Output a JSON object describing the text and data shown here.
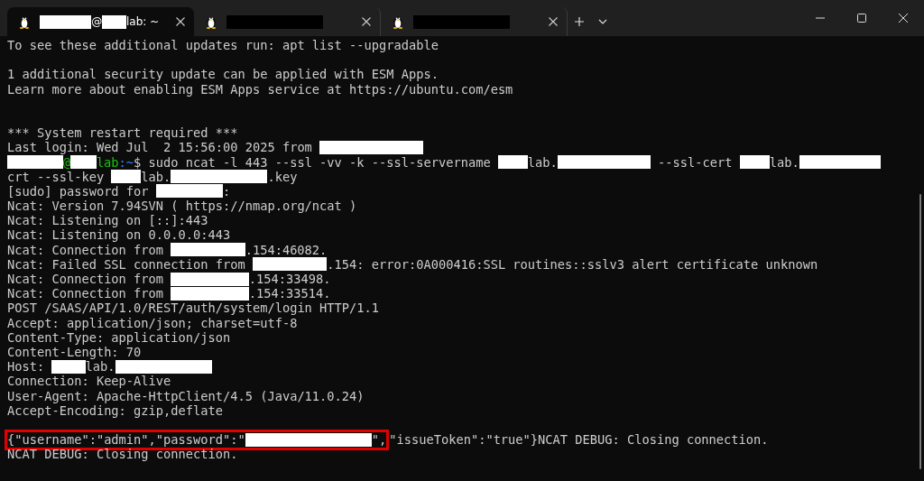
{
  "tabs": [
    {
      "selected": true,
      "title": [
        {
          "kind": "redacted"
        },
        {
          "kind": "text",
          "text": "@"
        },
        {
          "kind": "redacted"
        },
        {
          "kind": "text",
          "text": "lab: ~"
        }
      ]
    },
    {
      "selected": false,
      "title": [
        {
          "kind": "redacted"
        }
      ]
    },
    {
      "selected": false,
      "title": [
        {
          "kind": "redacted"
        }
      ]
    }
  ],
  "lines": [
    {
      "kind": "output",
      "segments": [
        {
          "kind": "text",
          "text": "To see these additional updates run: apt list --upgradable"
        }
      ]
    },
    {
      "kind": "blank"
    },
    {
      "kind": "output",
      "segments": [
        {
          "kind": "text",
          "text": "1 additional security update can be applied with ESM Apps."
        }
      ]
    },
    {
      "kind": "output",
      "segments": [
        {
          "kind": "text",
          "text": "Learn more about enabling ESM Apps service at https://ubuntu.com/esm"
        }
      ]
    },
    {
      "kind": "blank"
    },
    {
      "kind": "blank"
    },
    {
      "kind": "output",
      "segments": [
        {
          "kind": "text",
          "text": "*** System restart required ***"
        }
      ]
    },
    {
      "kind": "output",
      "segments": [
        {
          "kind": "text",
          "text": "Last login: Wed Jul  2 15:56:00 2025 from "
        },
        {
          "kind": "redacted"
        }
      ]
    },
    {
      "kind": "output",
      "segments": [
        {
          "kind": "redacted"
        },
        {
          "kind": "user",
          "text": "@"
        },
        {
          "kind": "redacted"
        },
        {
          "kind": "user",
          "text": "lab"
        },
        {
          "kind": "path",
          "text": ":~"
        },
        {
          "kind": "text",
          "text": "$ sudo ncat -l 443 --ssl -vv -k --ssl-servername "
        },
        {
          "kind": "redacted"
        },
        {
          "kind": "text",
          "text": "lab."
        },
        {
          "kind": "redacted"
        },
        {
          "kind": "text",
          "text": " --ssl-cert "
        },
        {
          "kind": "redacted"
        },
        {
          "kind": "text",
          "text": "lab."
        },
        {
          "kind": "redacted"
        }
      ]
    },
    {
      "kind": "output",
      "segments": [
        {
          "kind": "text",
          "text": "crt --ssl-key "
        },
        {
          "kind": "redacted"
        },
        {
          "kind": "text",
          "text": "lab."
        },
        {
          "kind": "redacted"
        },
        {
          "kind": "text",
          "text": ".key"
        }
      ]
    },
    {
      "kind": "output",
      "segments": [
        {
          "kind": "text",
          "text": "[sudo] password for "
        },
        {
          "kind": "redacted"
        },
        {
          "kind": "text",
          "text": ":"
        }
      ]
    },
    {
      "kind": "output",
      "segments": [
        {
          "kind": "text",
          "text": "Ncat: Version 7.94SVN ( https://nmap.org/ncat )"
        }
      ]
    },
    {
      "kind": "output",
      "segments": [
        {
          "kind": "text",
          "text": "Ncat: Listening on [::]:443"
        }
      ]
    },
    {
      "kind": "output",
      "segments": [
        {
          "kind": "text",
          "text": "Ncat: Listening on 0.0.0.0:443"
        }
      ]
    },
    {
      "kind": "output",
      "segments": [
        {
          "kind": "text",
          "text": "Ncat: Connection from "
        },
        {
          "kind": "redacted"
        },
        {
          "kind": "text",
          "text": ".154:46082."
        }
      ]
    },
    {
      "kind": "output",
      "segments": [
        {
          "kind": "text",
          "text": "Ncat: Failed SSL connection from "
        },
        {
          "kind": "redacted"
        },
        {
          "kind": "text",
          "text": ".154: error:0A000416:SSL routines::sslv3 alert certificate unknown"
        }
      ]
    },
    {
      "kind": "output",
      "segments": [
        {
          "kind": "text",
          "text": "Ncat: Connection from "
        },
        {
          "kind": "redacted"
        },
        {
          "kind": "text",
          "text": ".154:33498."
        }
      ]
    },
    {
      "kind": "output",
      "segments": [
        {
          "kind": "text",
          "text": "Ncat: Connection from "
        },
        {
          "kind": "redacted"
        },
        {
          "kind": "text",
          "text": ".154:33514."
        }
      ]
    },
    {
      "kind": "output",
      "segments": [
        {
          "kind": "text",
          "text": "POST /SAAS/API/1.0/REST/auth/system/login HTTP/1.1"
        }
      ]
    },
    {
      "kind": "output",
      "segments": [
        {
          "kind": "text",
          "text": "Accept: application/json; charset=utf-8"
        }
      ]
    },
    {
      "kind": "output",
      "segments": [
        {
          "kind": "text",
          "text": "Content-Type: application/json"
        }
      ]
    },
    {
      "kind": "output",
      "segments": [
        {
          "kind": "text",
          "text": "Content-Length: 70"
        }
      ]
    },
    {
      "kind": "output",
      "segments": [
        {
          "kind": "text",
          "text": "Host: "
        },
        {
          "kind": "redacted"
        },
        {
          "kind": "text",
          "text": "lab."
        },
        {
          "kind": "redacted"
        }
      ]
    },
    {
      "kind": "output",
      "segments": [
        {
          "kind": "text",
          "text": "Connection: Keep-Alive"
        }
      ]
    },
    {
      "kind": "output",
      "segments": [
        {
          "kind": "text",
          "text": "User-Agent: Apache-HttpClient/4.5 (Java/11.0.24)"
        }
      ]
    },
    {
      "kind": "output",
      "segments": [
        {
          "kind": "text",
          "text": "Accept-Encoding: gzip,deflate"
        }
      ]
    },
    {
      "kind": "blank"
    },
    {
      "kind": "output",
      "boxed": [
        {
          "kind": "text",
          "text": "{\"username\":\"admin\",\"password\":\""
        },
        {
          "kind": "redacted"
        },
        {
          "kind": "text",
          "text": "\","
        }
      ],
      "segments": [
        {
          "kind": "text",
          "text": "\"issueToken\":\"true\"}NCAT DEBUG: Closing connection."
        }
      ]
    },
    {
      "kind": "output",
      "segments": [
        {
          "kind": "text",
          "text": "NCAT DEBUG: Closing connection."
        }
      ]
    }
  ]
}
